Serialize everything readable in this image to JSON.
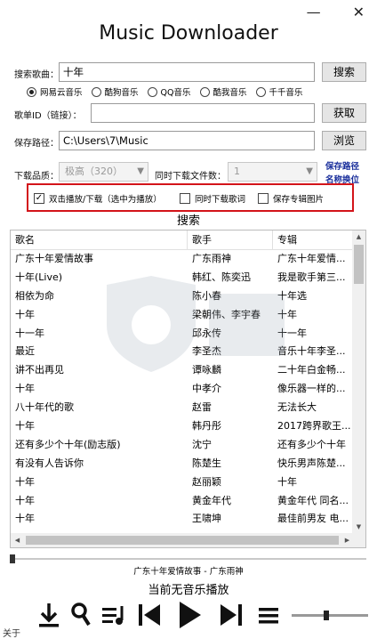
{
  "window": {
    "minimize": "—",
    "close": "✕",
    "title": "Music Downloader"
  },
  "search": {
    "label": "搜索歌曲：",
    "value": "十年",
    "button": "搜索"
  },
  "sources": [
    {
      "label": "网易云音乐",
      "checked": true
    },
    {
      "label": "酷狗音乐",
      "checked": false
    },
    {
      "label": "QQ音乐",
      "checked": false
    },
    {
      "label": "酷我音乐",
      "checked": false
    },
    {
      "label": "千千音乐",
      "checked": false
    }
  ],
  "playlist": {
    "label": "歌单ID（链接）：",
    "value": "",
    "button": "获取"
  },
  "save_path": {
    "label": "保存路径：",
    "value": "C:\\Users\\7\\Music",
    "button": "浏览"
  },
  "quality": {
    "label": "下载品质：",
    "value": "极高（320）"
  },
  "concurrent": {
    "label": "同时下载文件数：",
    "value": "1"
  },
  "links": {
    "save_path": "保存路径",
    "name_position": "名称换位"
  },
  "options": {
    "double_click": {
      "label": "双击播放/下载（选中为播放）",
      "checked": true
    },
    "lyrics": {
      "label": "同时下载歌词",
      "checked": false
    },
    "album_art": {
      "label": "保存专辑图片",
      "checked": false
    }
  },
  "results_title": "搜索",
  "table": {
    "headers": [
      "歌名",
      "歌手",
      "专辑"
    ],
    "rows": [
      [
        "广东十年爱情故事",
        "广东雨神",
        "广东十年爱情..."
      ],
      [
        "十年(Live)",
        "韩红、陈奕迅",
        "我是歌手第三..."
      ],
      [
        "相依为命",
        "陈小春",
        "十年选"
      ],
      [
        "十年",
        "梁朝伟、李宇春",
        "十年"
      ],
      [
        "十一年",
        "邱永传",
        "十一年"
      ],
      [
        "最近",
        "李圣杰",
        "音乐十年李圣..."
      ],
      [
        "讲不出再见",
        "谭咏麟",
        "二十年白金畅..."
      ],
      [
        "十年",
        "中孝介",
        "像乐器一样的..."
      ],
      [
        "八十年代的歌",
        "赵雷",
        "无法长大"
      ],
      [
        "十年",
        "韩丹彤",
        "2017跨界歌王..."
      ],
      [
        "还有多少个十年(励志版)",
        "沈宁",
        "还有多少个十年"
      ],
      [
        "有没有人告诉你",
        "陈楚生",
        "快乐男声陈楚..."
      ],
      [
        "十年",
        "赵丽颖",
        "十年"
      ],
      [
        "十年",
        "黄金年代",
        "黄金年代 同名..."
      ],
      [
        "十年",
        "王啸坤",
        "最佳前男友 电..."
      ]
    ]
  },
  "player": {
    "track": "广东十年爱情故事 - 广东雨神",
    "status": "当前无音乐播放",
    "progress": 0,
    "volume": 0.45
  },
  "footer": {
    "about": "关于"
  },
  "colors": {
    "highlight_border": "#d3141a",
    "link": "#1a2f9c"
  }
}
